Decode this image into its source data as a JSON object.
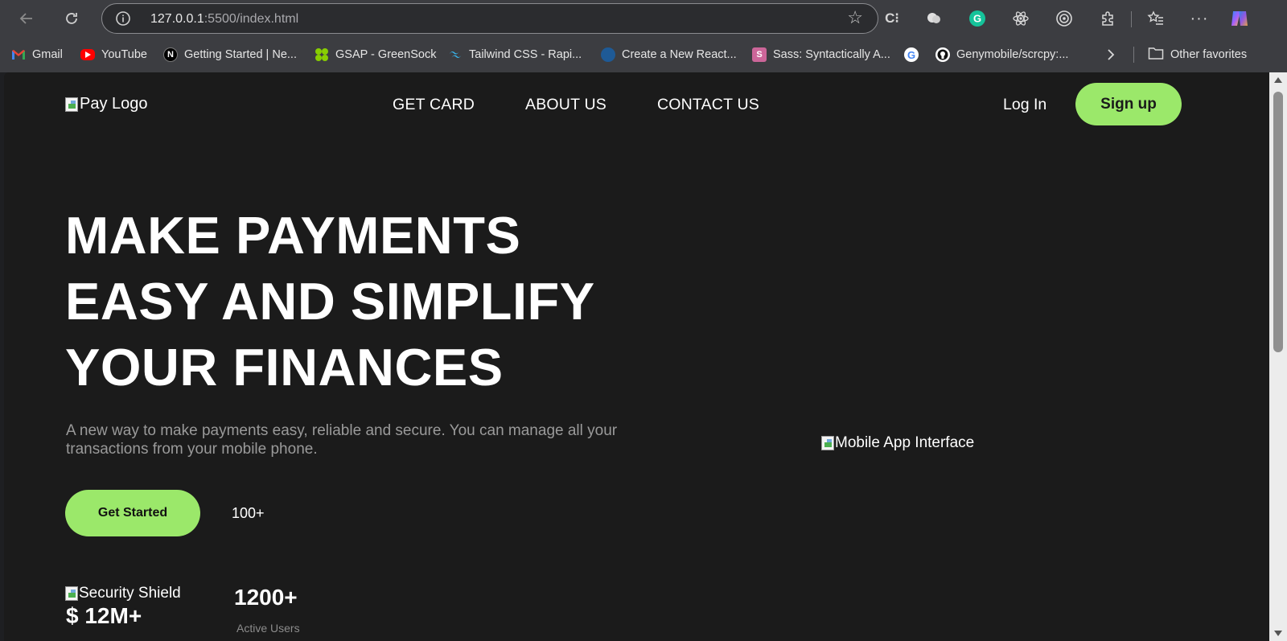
{
  "browser": {
    "url_host": "127.0.0.1",
    "url_rest": ":5500/index.html",
    "bookmarks": [
      {
        "label": "Gmail",
        "icon": "gmail-icon",
        "color": "#ea4335"
      },
      {
        "label": "YouTube",
        "icon": "youtube-icon",
        "color": "#ff0000"
      },
      {
        "label": "Getting Started | Ne...",
        "icon": "nextjs-icon",
        "color": "#000000"
      },
      {
        "label": "GSAP - GreenSock",
        "icon": "gsap-icon",
        "color": "#88ce02"
      },
      {
        "label": "Tailwind CSS - Rapi...",
        "icon": "tailwind-icon",
        "color": "#38bdf8"
      },
      {
        "label": "Create a New React...",
        "icon": "react-icon",
        "color": "#1e5a96"
      },
      {
        "label": "Sass: Syntactically A...",
        "icon": "sass-icon",
        "color": "#cc6699"
      },
      {
        "label": "",
        "icon": "google-icon",
        "color": "#4285f4"
      },
      {
        "label": "Genymobile/scrcpy:...",
        "icon": "github-icon",
        "color": "#ffffff"
      }
    ],
    "other_favorites": "Other favorites"
  },
  "site": {
    "logo_alt": "Pay Logo",
    "nav": [
      "GET CARD",
      "ABOUT US",
      "CONTACT US"
    ],
    "login": "Log In",
    "signup": "Sign up",
    "hero_lines": [
      "MAKE PAYMENTS",
      "EASY AND SIMPLIFY",
      "YOUR FINANCES"
    ],
    "subtitle": "A new way to make payments easy, reliable and secure. You can manage all your transactions from your mobile phone.",
    "cta": "Get Started",
    "count_small": "100+",
    "mobile_img_alt": "Mobile App Interface",
    "shield_alt": "Security Shield",
    "stat_a": "$ 12M+",
    "stat_b": "1200+",
    "stat_b_label": "Active Users",
    "accent": "#9be86a"
  }
}
